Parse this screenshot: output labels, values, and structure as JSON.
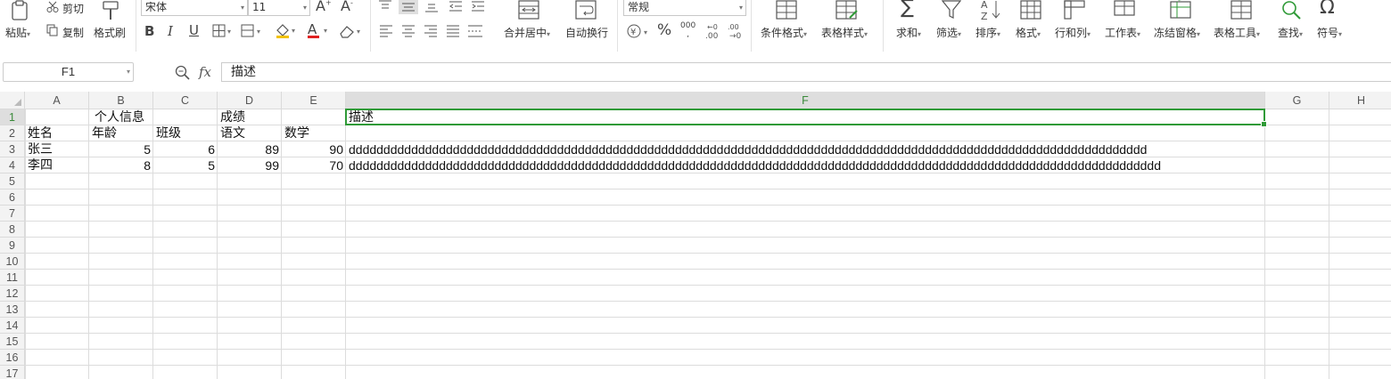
{
  "ribbon": {
    "paste": "粘贴",
    "cut": "剪切",
    "copy": "复制",
    "format_painter": "格式刷",
    "font_name": "宋体",
    "font_size": "11",
    "merge_center": "合并居中",
    "wrap_text": "自动换行",
    "number_format": "常规",
    "conditional_format": "条件格式",
    "table_style": "表格样式",
    "sum": "求和",
    "filter": "筛选",
    "sort": "排序",
    "format": "格式",
    "row_col": "行和列",
    "worksheet": "工作表",
    "freeze_panes": "冻结窗格",
    "table_tools": "表格工具",
    "find": "查找",
    "symbol": "符号",
    "bold": "B",
    "italic": "I",
    "underline": "U",
    "font_grow": "A",
    "font_shrink": "A",
    "font_color_letter": "A",
    "percent": "%",
    "thousands": "000",
    "fx": "fx",
    "accent_green": "#2f9a37"
  },
  "formula_bar": {
    "name_box": "F1",
    "content": "描述"
  },
  "sheet": {
    "columns": [
      "A",
      "B",
      "C",
      "D",
      "E",
      "F",
      "G",
      "H"
    ],
    "selected_column": "F",
    "selected_row": "1",
    "rows": [
      "1",
      "2",
      "3",
      "4",
      "5",
      "6",
      "7",
      "8",
      "9",
      "10",
      "11",
      "12",
      "13",
      "14",
      "15",
      "16",
      "17"
    ],
    "cells": {
      "B1": "个人信息",
      "D1": "成绩",
      "F1": "描述",
      "A2": "姓名",
      "B2": "年龄",
      "C2": "班级",
      "D2": "语文",
      "E2": "数学",
      "A3": "张三",
      "B3": "5",
      "C3": "6",
      "D3": "89",
      "E3": "90",
      "F3": "ddddddddddddddddddddddddddddddddddddddddddddddddddddddddddddddddddddddddddddddddddddddddddddddddddddddddddddddddddd",
      "A4": "李四",
      "B4": "8",
      "C4": "5",
      "D4": "99",
      "E4": "70",
      "F4": "ddddddddddddddddddddddddddddddddddddddddddddddddddddddddddddddddddddddddddddddddddddddddddddddddddddddddddddddddddddd"
    }
  }
}
